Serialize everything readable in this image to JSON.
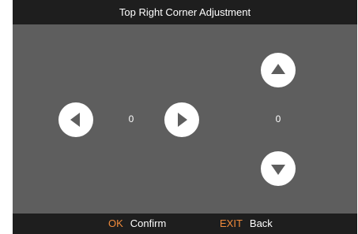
{
  "title": "Top Right Corner Adjustment",
  "horizontal_value": "0",
  "vertical_value": "0",
  "footer": {
    "ok_key": "OK",
    "ok_label": "Confirm",
    "exit_key": "EXIT",
    "exit_label": "Back"
  },
  "icons": {
    "left": "triangle-left-icon",
    "right": "triangle-right-icon",
    "up": "triangle-up-icon",
    "down": "triangle-down-icon"
  },
  "colors": {
    "panel_background": "#5e5e5e",
    "bar_background": "#1e1e1e",
    "key_accent": "#ef8a3b",
    "button_fill": "#ffffff",
    "arrow_fill": "#5e5e5e"
  }
}
